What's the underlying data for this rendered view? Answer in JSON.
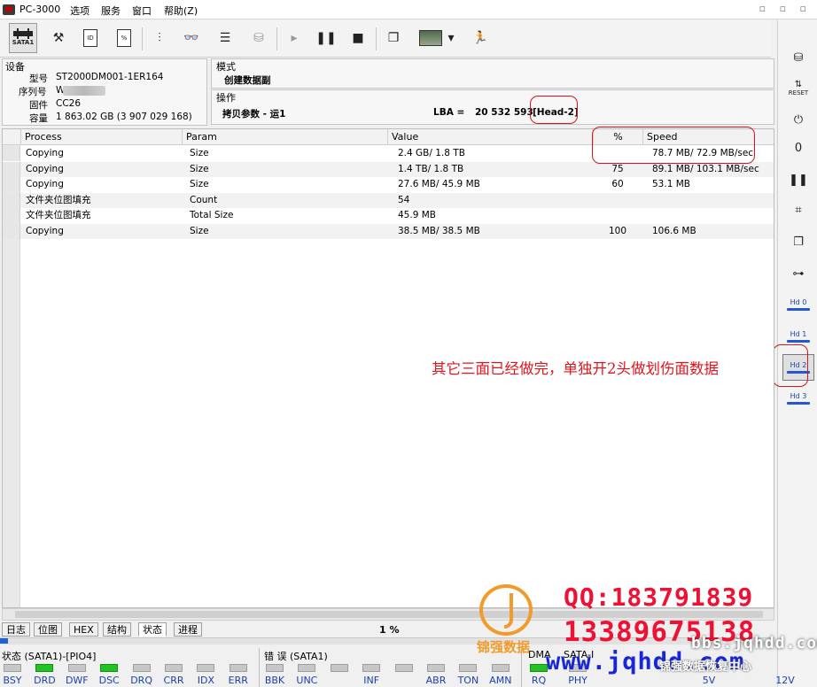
{
  "app": {
    "title": "PC-3000",
    "menu": [
      "选项",
      "服务",
      "窗口",
      "帮助(Z)"
    ]
  },
  "toolbar": {
    "sata_label": "SATA1",
    "doc2_text": "100\n%"
  },
  "device": {
    "section_label": "设备",
    "model_label": "型号",
    "model_value": "ST2000DM001-1ER164",
    "serial_label": "序列号",
    "serial_value": "W",
    "firmware_label": "固件",
    "firmware_value": "CC26",
    "capacity_label": "容量",
    "capacity_value": "1 863.02 GB (3 907 029 168)"
  },
  "mode": {
    "label": "模式",
    "value": "创建数据副",
    "operation_label": "操作",
    "operation_value": "拷贝参数 - 运1",
    "lba_label": "LBA =",
    "lba_value": "20 532 593",
    "head_value": "[Head-2]"
  },
  "table": {
    "columns": [
      "Process",
      "Param",
      "Value",
      "%",
      "Speed"
    ],
    "rows": [
      {
        "process": "Copying",
        "param": "Size",
        "value": "2.4 GB/ 1.8 TB",
        "pct": "",
        "speed": "78.7 MB/ 72.9 MB/sec"
      },
      {
        "process": "Copying",
        "param": "Size",
        "value": "1.4 TB/ 1.8 TB",
        "pct": "75",
        "speed": "89.1 MB/ 103.1 MB/sec"
      },
      {
        "process": "Copying",
        "param": "Size",
        "value": "27.6 MB/ 45.9 MB",
        "pct": "60",
        "speed": "53.1 MB"
      },
      {
        "process": "文件夹位图填充",
        "param": "Count",
        "value": "54",
        "pct": "",
        "speed": ""
      },
      {
        "process": "文件夹位图填充",
        "param": "Total Size",
        "value": "45.9 MB",
        "pct": "",
        "speed": ""
      },
      {
        "process": "Copying",
        "param": "Size",
        "value": "38.5 MB/ 38.5 MB",
        "pct": "100",
        "speed": "106.6 MB"
      }
    ]
  },
  "annotation": "其它三面已经做完，单独开2头做划伤面数据",
  "tabs": [
    "日志",
    "位图",
    "HEX",
    "结构",
    "状态",
    "进程"
  ],
  "active_tab": 4,
  "progress": {
    "label": "1 %",
    "fraction": 0.01
  },
  "status": {
    "group_label": "状态 (SATA1)-[PIO4]",
    "leds": [
      {
        "name": "BSY",
        "on": false
      },
      {
        "name": "DRD",
        "on": true
      },
      {
        "name": "DWF",
        "on": false
      },
      {
        "name": "DSC",
        "on": true
      },
      {
        "name": "DRQ",
        "on": false
      },
      {
        "name": "CRR",
        "on": false
      },
      {
        "name": "IDX",
        "on": false
      },
      {
        "name": "ERR",
        "on": false
      }
    ]
  },
  "errors": {
    "group_label": "错 误 (SATA1)",
    "leds": [
      "BBK",
      "UNC",
      "",
      "INF",
      "",
      "ABR",
      "TON",
      "AMN"
    ]
  },
  "dma": {
    "group_label": "DMA",
    "group_label_2": "SATA-I",
    "leds": [
      {
        "name": "RQ",
        "on": true
      },
      {
        "name": "PHY",
        "on": false
      }
    ]
  },
  "power": {
    "labels": [
      "5V",
      "12V"
    ]
  },
  "right_toolbar": {
    "hd_labels": [
      "Hd 0",
      "Hd 1",
      "Hd 2",
      "Hd 3"
    ],
    "selected": 2,
    "reset_label": "RESET"
  },
  "watermark": {
    "qq": "QQ:183791839",
    "phone": "13389675138",
    "site": "www.jqhdd.com",
    "site2": "bbs.jqhdd.com",
    "brand": "锦强数据",
    "slogan": "锦强数据恢复中心"
  },
  "colors": {
    "annotation": "#e3161e",
    "led_on": "#22c322",
    "progress": "#1e62d6",
    "watermark": "#ee1133"
  }
}
